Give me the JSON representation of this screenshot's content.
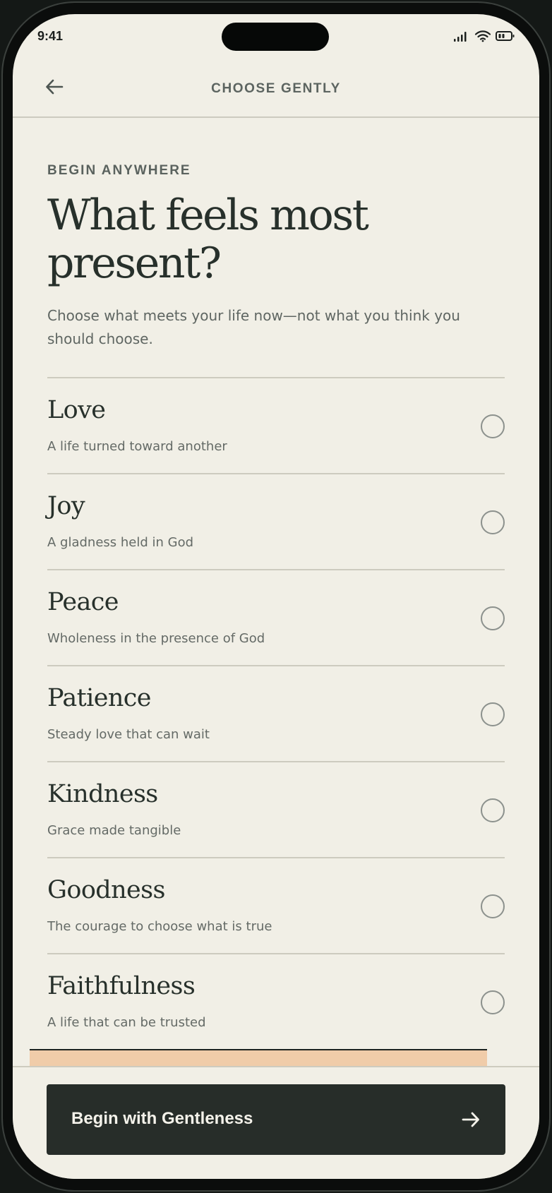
{
  "status_bar": {
    "time": "9:41"
  },
  "header": {
    "title": "CHOOSE GENTLY",
    "back_icon": "arrow-left-icon"
  },
  "intro": {
    "eyebrow": "BEGIN ANYWHERE",
    "headline": "What feels most present?",
    "subtitle": "Choose what meets your life now—not what you think you should choose."
  },
  "options": [
    {
      "title": "Love",
      "description": "A life turned toward another",
      "selected": false
    },
    {
      "title": "Joy",
      "description": "A gladness held in God",
      "selected": false
    },
    {
      "title": "Peace",
      "description": "Wholeness in the presence of God",
      "selected": false
    },
    {
      "title": "Patience",
      "description": "Steady love that can wait",
      "selected": false
    },
    {
      "title": "Kindness",
      "description": "Grace made tangible",
      "selected": false
    },
    {
      "title": "Goodness",
      "description": "The courage to choose what is true",
      "selected": false
    },
    {
      "title": "Faithfulness",
      "description": "A life that can be trusted",
      "selected": false
    }
  ],
  "cta": {
    "label": "Begin with Gentleness",
    "icon": "arrow-right-icon"
  },
  "colors": {
    "background": "#f1efe6",
    "ink": "#27302b",
    "cta_background": "#272d29",
    "accent_peach": "#f0cca9"
  }
}
